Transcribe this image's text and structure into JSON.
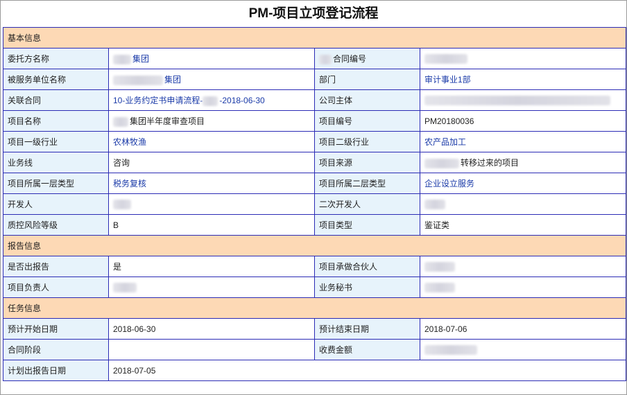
{
  "title": "PM-项目立项登记流程",
  "sections": {
    "basic": "基本信息",
    "report": "报告信息",
    "task": "任务信息"
  },
  "fields": {
    "client_name": {
      "label": "委托方名称",
      "value": "集团"
    },
    "contract_no": {
      "label": "合同编号",
      "value": "合同编号"
    },
    "served_unit": {
      "label": "被服务单位名称",
      "value": "集团"
    },
    "department": {
      "label": "部门",
      "value": "审计事业1部"
    },
    "related_contract": {
      "label": "关联合同",
      "value_prefix": "10-业务约定书申请流程-",
      "value_suffix": "-2018-06-30"
    },
    "company_entity": {
      "label": "公司主体",
      "value": ""
    },
    "project_name": {
      "label": "项目名称",
      "value": "集团半年度审查项目"
    },
    "project_no": {
      "label": "项目编号",
      "value": "PM20180036"
    },
    "industry_l1": {
      "label": "项目一级行业",
      "value": "农林牧渔"
    },
    "industry_l2": {
      "label": "项目二级行业",
      "value": "农产品加工"
    },
    "business_line": {
      "label": "业务线",
      "value": "咨询"
    },
    "project_source": {
      "label": "项目来源",
      "value": "转移过来的项目"
    },
    "type_l1": {
      "label": "项目所属一层类型",
      "value": "税务复核"
    },
    "type_l2": {
      "label": "项目所属二层类型",
      "value": "企业设立服务"
    },
    "developer": {
      "label": "开发人",
      "value": ""
    },
    "secondary_developer": {
      "label": "二次开发人",
      "value": ""
    },
    "risk_level": {
      "label": "质控风险等级",
      "value": "B"
    },
    "project_type": {
      "label": "项目类型",
      "value": "鉴证类"
    },
    "has_report": {
      "label": "是否出报告",
      "value": "是"
    },
    "partner": {
      "label": "项目承做合伙人",
      "value": ""
    },
    "project_lead": {
      "label": "项目负责人",
      "value": ""
    },
    "secretary": {
      "label": "业务秘书",
      "value": ""
    },
    "planned_start": {
      "label": "预计开始日期",
      "value": "2018-06-30"
    },
    "planned_end": {
      "label": "预计结束日期",
      "value": "2018-07-06"
    },
    "contract_stage": {
      "label": "合同阶段",
      "value": ""
    },
    "fee_amount": {
      "label": "收费金额",
      "value": ""
    },
    "planned_report_date": {
      "label": "计划出报告日期",
      "value": "2018-07-05"
    }
  },
  "colors": {
    "section_bg": "#fdd9b5",
    "label_bg": "#e7f3fb",
    "border": "#2b2bb5",
    "link_text": "#1a3aa8"
  }
}
